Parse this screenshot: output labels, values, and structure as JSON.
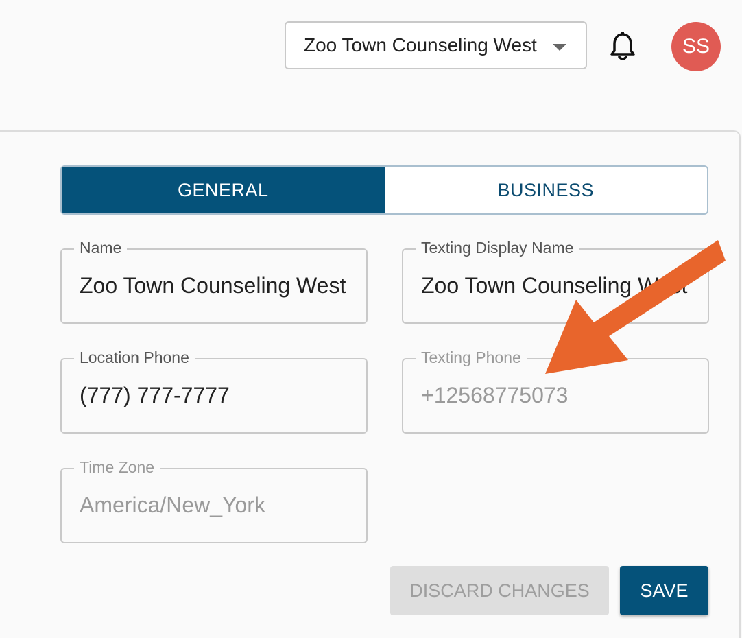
{
  "header": {
    "location_select": {
      "value": "Zoo Town Counseling West"
    },
    "avatar_initials": "SS",
    "avatar_color": "#e05b54"
  },
  "tabs": [
    {
      "label": "GENERAL",
      "active": true
    },
    {
      "label": "BUSINESS",
      "active": false
    }
  ],
  "form": {
    "name": {
      "label": "Name",
      "value": "Zoo Town Counseling West"
    },
    "texting_display_name": {
      "label": "Texting Display Name",
      "value": "Zoo Town Counseling West"
    },
    "location_phone": {
      "label": "Location Phone",
      "value": "(777) 777-7777"
    },
    "texting_phone": {
      "label": "Texting Phone",
      "value": "+12568775073"
    },
    "time_zone": {
      "label": "Time Zone",
      "value": "America/New_York"
    }
  },
  "actions": {
    "discard_label": "DISCARD CHANGES",
    "save_label": "SAVE"
  },
  "colors": {
    "primary": "#05527a",
    "annotation_arrow": "#e8652c"
  }
}
